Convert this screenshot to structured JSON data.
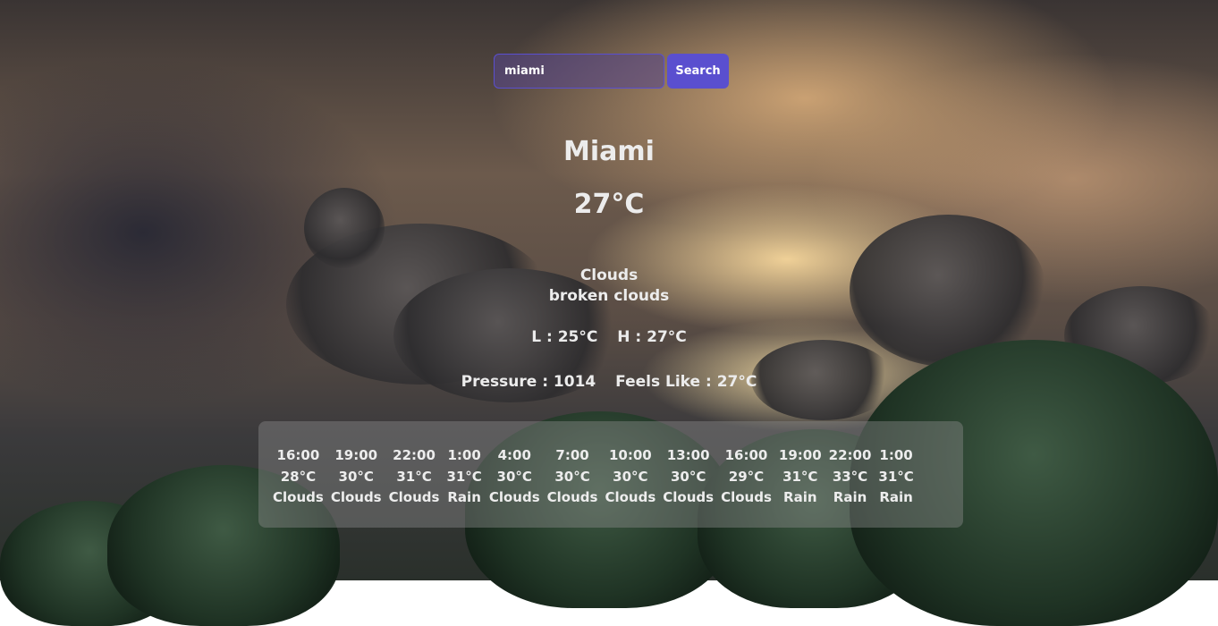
{
  "search": {
    "value": "miami",
    "button_label": "Search"
  },
  "weather": {
    "city": "Miami",
    "temperature": "27°C",
    "condition": "Clouds",
    "description": "broken clouds",
    "low": "L : 25°C",
    "high": "H : 27°C",
    "pressure": "Pressure : 1014",
    "feels_like": "Feels Like : 27°C"
  },
  "forecast": [
    {
      "time": "16:00",
      "temp": "28°C",
      "cond": "Clouds"
    },
    {
      "time": "19:00",
      "temp": "30°C",
      "cond": "Clouds"
    },
    {
      "time": "22:00",
      "temp": "31°C",
      "cond": "Clouds"
    },
    {
      "time": "1:00",
      "temp": "31°C",
      "cond": "Rain"
    },
    {
      "time": "4:00",
      "temp": "30°C",
      "cond": "Clouds"
    },
    {
      "time": "7:00",
      "temp": "30°C",
      "cond": "Clouds"
    },
    {
      "time": "10:00",
      "temp": "30°C",
      "cond": "Clouds"
    },
    {
      "time": "13:00",
      "temp": "30°C",
      "cond": "Clouds"
    },
    {
      "time": "16:00",
      "temp": "29°C",
      "cond": "Clouds"
    },
    {
      "time": "19:00",
      "temp": "31°C",
      "cond": "Rain"
    },
    {
      "time": "22:00",
      "temp": "33°C",
      "cond": "Rain"
    },
    {
      "time": "1:00",
      "temp": "31°C",
      "cond": "Rain"
    }
  ],
  "colors": {
    "accent": "#5a4fcf",
    "text": "#ececec",
    "panel": "rgba(140,140,140,0.42)"
  }
}
